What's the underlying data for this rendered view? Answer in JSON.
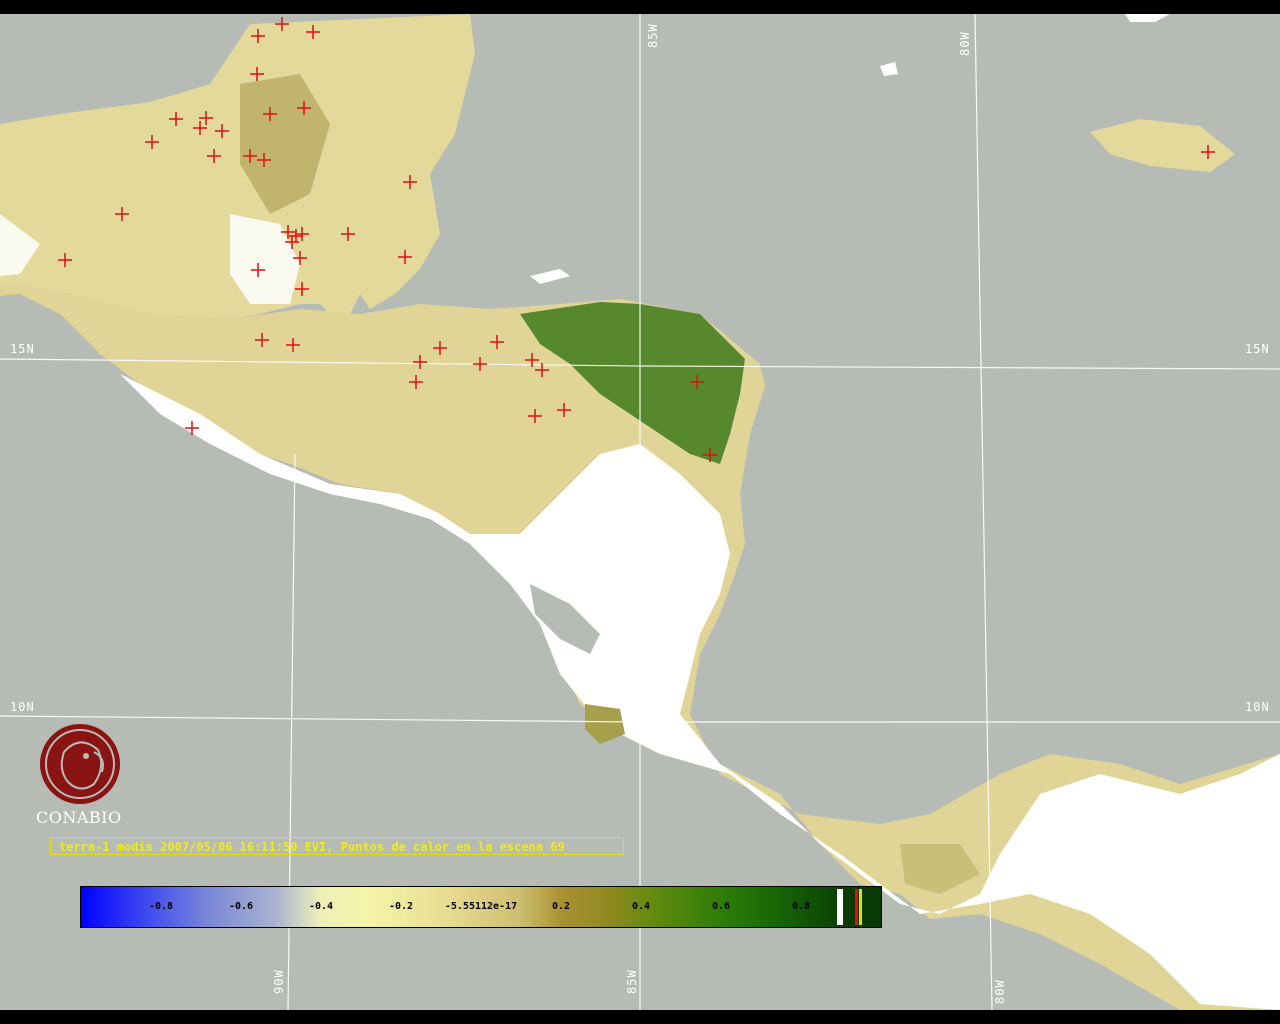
{
  "map": {
    "grid_labels": {
      "lon_top": [
        "85W",
        "80W"
      ],
      "lon_bottom": [
        "90W",
        "85W",
        "80W"
      ],
      "lat_left": [
        "15N",
        "10N"
      ],
      "lat_right": [
        "15N",
        "10N"
      ]
    }
  },
  "logo": {
    "text": "CONABIO"
  },
  "caption": {
    "text": "terra-1 modis 2007/05/06 16:11:50 EVI, Puntos de calor en la escena 69"
  },
  "colorbar": {
    "ticks": [
      "-0.8",
      "-0.6",
      "-0.4",
      "-0.2",
      "-5.55112e-17",
      "0.2",
      "0.4",
      "0.6",
      "0.8"
    ]
  },
  "colors": {
    "ocean": "#b6bbb5",
    "cloud": "#ffffff",
    "hotspot": "#e01010",
    "caption": "#f2ea20"
  }
}
